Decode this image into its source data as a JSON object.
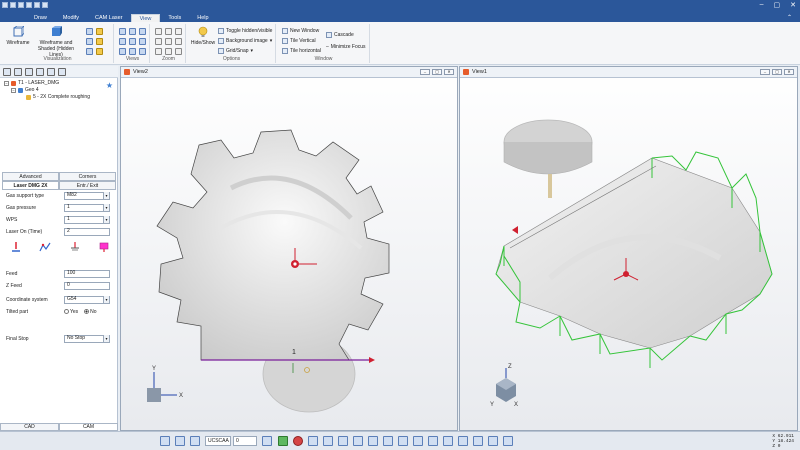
{
  "menu": {
    "items": [
      "Draw",
      "Modify",
      "CAM Laser",
      "View",
      "Tools",
      "Help"
    ],
    "active": "View",
    "window_controls": [
      "–",
      "▢",
      "✕"
    ]
  },
  "ribbon": {
    "visualization": {
      "label": "Visualization",
      "wireframe": "Wireframe",
      "wireframe_shaded": "Wireframe and Shaded (Hidden Lines)"
    },
    "views_label": "Views",
    "zoom_label": "Zoom",
    "options": {
      "label": "Options",
      "hide_show": "Hide/Show",
      "toggle_hidden": "Toggle hidden/visible",
      "background_image": "Background image",
      "grid_snap": "Grid/Snap"
    },
    "window": {
      "label": "Window",
      "new_window": "New Window",
      "cascade": "Cascade",
      "tile_vertical": "Tile Vertical",
      "tile_horizontal": "Tile horizontal",
      "minimize_focus": "Minimize Focus"
    }
  },
  "tree": {
    "root": "T1 - LASER_DMG",
    "geo": "Geo 4",
    "op": "5 - 2X Complete roughing"
  },
  "params": {
    "tabs_top": [
      "Advanced",
      "Corners"
    ],
    "tabs_bottom": [
      "Laser DMG 2X",
      "Entr./ Exit"
    ],
    "gas_support_label": "Gas support type",
    "gas_support_value": "M82",
    "gas_pressure_label": "Gas pressure",
    "gas_pressure_value": "1",
    "wps_label": "WPS",
    "wps_value": "1",
    "laser_on_label": "Laser On (Time)",
    "laser_on_value": "2",
    "feed_label": "Feed",
    "feed_value": "100",
    "zfeed_label": "Z Feed",
    "zfeed_value": "0",
    "coord_label": "Coordinate system",
    "coord_value": "G54",
    "tilted_label": "Tilted part",
    "tilted_yes": "Yes",
    "tilted_no": "No",
    "final_stop_label": "Final Stop",
    "final_stop_value": "No Stop"
  },
  "bottom_tabs": [
    "CAD",
    "CAM"
  ],
  "view_left": {
    "title": "View2",
    "label_1": "1",
    "axis_y": "Y",
    "axis_x": "X"
  },
  "view_right": {
    "title": "View1",
    "axis_z": "Z",
    "axis_x": "X",
    "axis_y": "Y"
  },
  "status": {
    "ucs": "UCSCAA",
    "z_value": "0",
    "coords": [
      "X 62.911",
      "Y 18.424",
      "Z 0"
    ]
  }
}
